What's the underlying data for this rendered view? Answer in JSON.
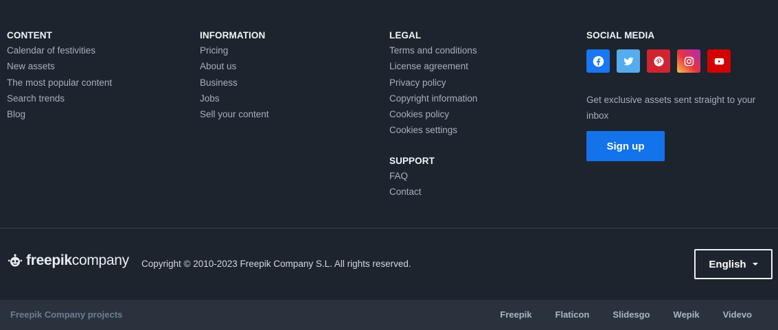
{
  "content": {
    "title": "CONTENT",
    "links": [
      "Calendar of festivities",
      "New assets",
      "The most popular content",
      "Search trends",
      "Blog"
    ]
  },
  "information": {
    "title": "INFORMATION",
    "links": [
      "Pricing",
      "About us",
      "Business",
      "Jobs",
      "Sell your content"
    ]
  },
  "legal": {
    "title": "LEGAL",
    "links": [
      "Terms and conditions",
      "License agreement",
      "Privacy policy",
      "Copyright information",
      "Cookies policy",
      "Cookies settings"
    ]
  },
  "support": {
    "title": "SUPPORT",
    "links": [
      "FAQ",
      "Contact"
    ]
  },
  "social": {
    "title": "SOCIAL MEDIA",
    "icons": [
      "facebook-icon",
      "twitter-icon",
      "pinterest-icon",
      "instagram-icon",
      "youtube-icon"
    ],
    "newsletter_text": "Get exclusive assets sent straight to your inbox",
    "signup_label": "Sign up"
  },
  "brand": {
    "logo_text_bold": "freepik",
    "logo_text_light": "company",
    "copyright": "Copyright ©  2010-2023 Freepik Company S.L. All rights reserved."
  },
  "language": {
    "selected": "English"
  },
  "projects": {
    "label": "Freepik Company projects",
    "links": [
      "Freepik",
      "Flaticon",
      "Slidesgo",
      "Wepik",
      "Videvo"
    ]
  },
  "colors": {
    "background": "#1d242d",
    "projects_bar": "#2a323d",
    "accent_button": "#1273eb",
    "facebook": "#1877f2",
    "twitter": "#55acee",
    "pinterest": "#d22331",
    "youtube": "#d40000"
  }
}
